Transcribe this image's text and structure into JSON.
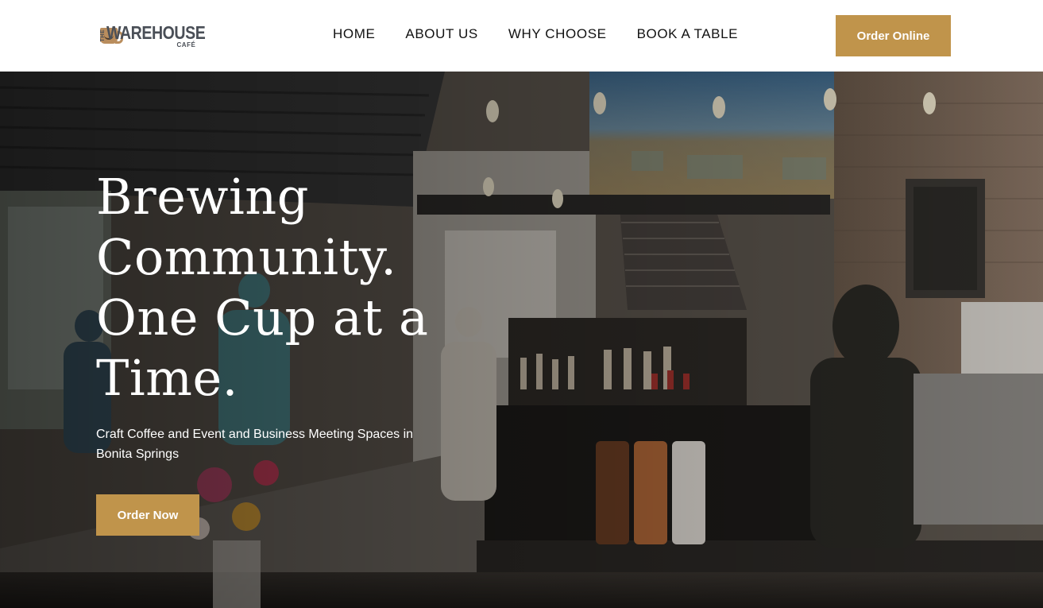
{
  "brand": {
    "prefix": "THE",
    "name": "WAREHOUSE",
    "sub": "CAFÉ",
    "logo_icon": "coffee-cup-icon"
  },
  "nav": {
    "items": [
      "HOME",
      "ABOUT US",
      "WHY CHOOSE",
      "BOOK A TABLE"
    ]
  },
  "header": {
    "cta_label": "Order Online"
  },
  "hero": {
    "title": "Brewing Community. One Cup at a Time.",
    "subtitle": "Craft Coffee and Event and Business Meeting Spaces in Bonita Springs",
    "cta_label": "Order Now"
  },
  "colors": {
    "accent": "#c0944b",
    "logo_text": "#4a4f57",
    "logo_icon": "#b98d5d",
    "nav_text": "#111111"
  }
}
